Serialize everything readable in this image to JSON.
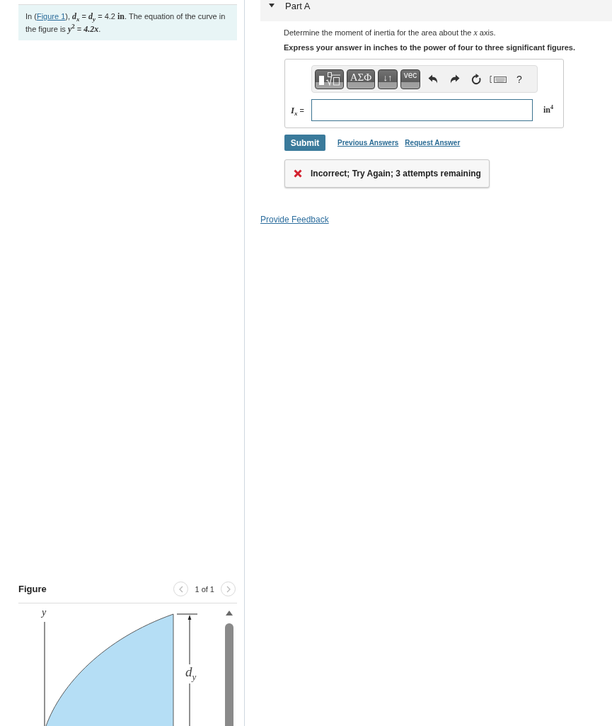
{
  "problem": {
    "lead": "In (",
    "figure_link": "Figure 1",
    "text": "), *d*$_{x}$ = *d*$_{y}$ = 4.2 **in**. The equation of the curve in the figure is *y*$^{2}$ = *4.2x*."
  },
  "figure": {
    "title": "Figure",
    "pager": "1 of 1",
    "axis_label": "y",
    "dimension_label": "*d*$_{y}$"
  },
  "part": {
    "title": "Part A",
    "expanded": true,
    "question": "Determine the moment of inertia for the area about the *x* axis.",
    "instruction": "Express your answer in inches to the power of four to three significant figures."
  },
  "answer": {
    "toolbar": [
      {
        "kind": "templates"
      },
      {
        "kind": "greek",
        "label": "ΑΣΦ"
      },
      {
        "kind": "arrows",
        "label": "↓↑"
      },
      {
        "kind": "vector",
        "label": "vec"
      },
      {
        "kind": "undo"
      },
      {
        "kind": "redo"
      },
      {
        "kind": "reset"
      },
      {
        "kind": "keyboard"
      },
      {
        "kind": "help",
        "label": "?"
      }
    ],
    "variable": "*I*$_{x}$ =",
    "unit": "in$^{4}$"
  },
  "actions": {
    "submit": "Submit",
    "links": [
      "Previous Answers",
      "Request Answer"
    ]
  },
  "feedback": {
    "correct": false,
    "message": "Incorrect; Try Again; 3 attempts remaining"
  },
  "provide_feedback": "Provide Feedback"
}
